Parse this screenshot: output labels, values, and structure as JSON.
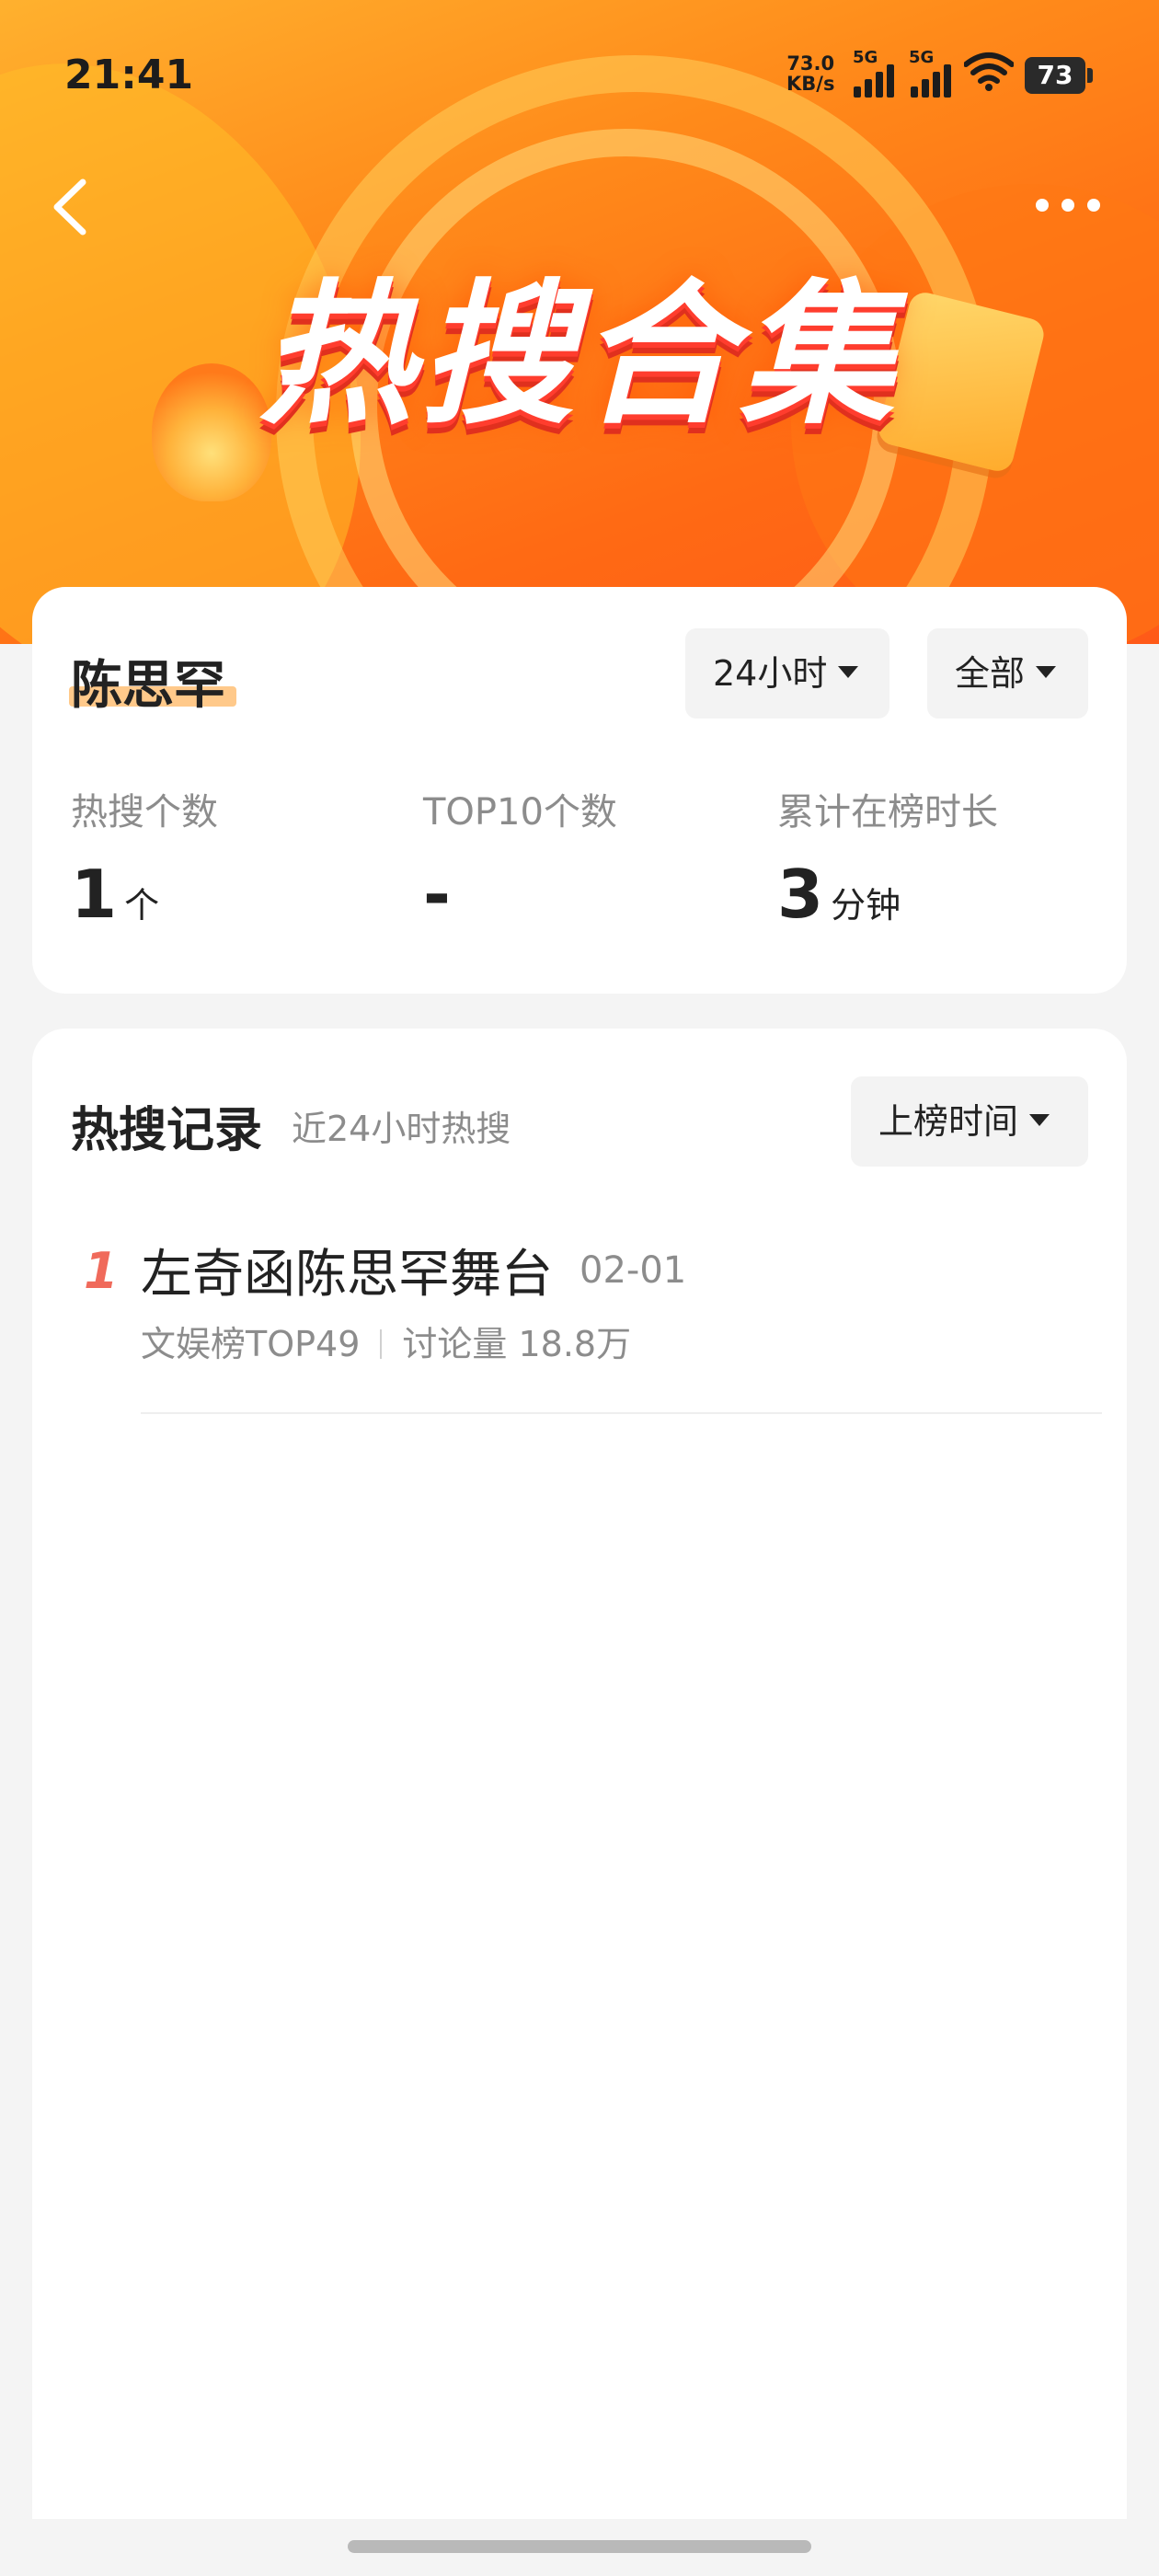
{
  "status_bar": {
    "time": "21:41",
    "net_speed_value": "73.0",
    "net_speed_unit": "KB/s",
    "signal1_label": "5G",
    "signal2_label": "5G",
    "battery": "73"
  },
  "hero": {
    "title": "热搜合集"
  },
  "summary": {
    "name": "陈思罕",
    "filter_time": "24小时",
    "filter_scope": "全部",
    "stats": [
      {
        "label": "热搜个数",
        "value": "1",
        "unit": "个"
      },
      {
        "label": "TOP10个数",
        "value": "-",
        "unit": ""
      },
      {
        "label": "累计在榜时长",
        "value": "3",
        "unit": "分钟"
      }
    ]
  },
  "records": {
    "title": "热搜记录",
    "subtitle": "近24小时热搜",
    "sort_label": "上榜时间",
    "items": [
      {
        "rank": "1",
        "title": "左奇函陈思罕舞台",
        "date": "02-01",
        "board": "文娱榜TOP49",
        "discussion": "讨论量 18.8万"
      }
    ]
  },
  "colors": {
    "accent_orange": "#ff7a1a",
    "rank_red": "#f06a5b",
    "name_highlight": "#ffc98a"
  }
}
